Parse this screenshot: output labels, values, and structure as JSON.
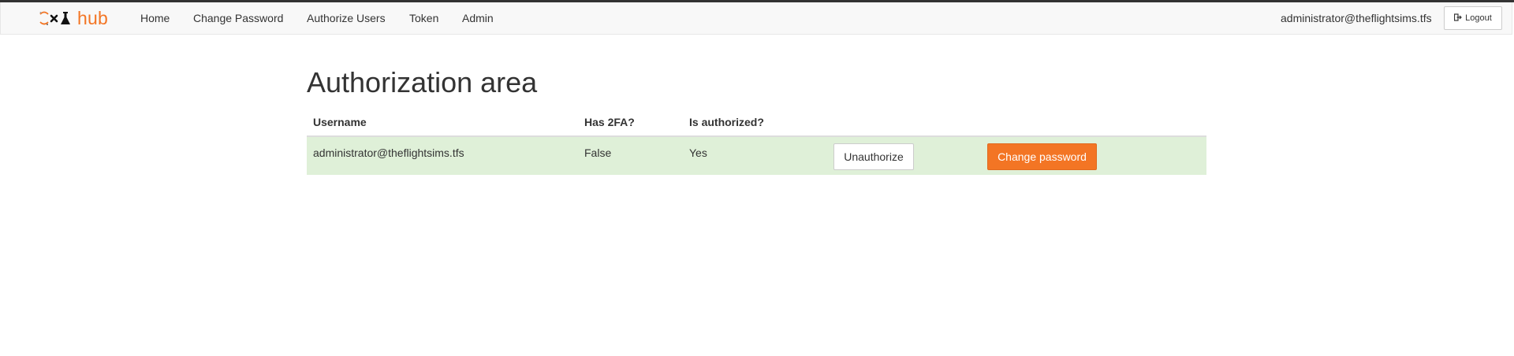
{
  "brand": {
    "logo_text": "hub",
    "accent_color": "#f37524"
  },
  "nav": {
    "items": [
      {
        "label": "Home"
      },
      {
        "label": "Change Password"
      },
      {
        "label": "Authorize Users"
      },
      {
        "label": "Token"
      },
      {
        "label": "Admin"
      }
    ]
  },
  "user": {
    "email": "administrator@theflightsims.tfs",
    "logout_label": "Logout",
    "logout_icon": "sign-out-icon"
  },
  "main": {
    "title": "Authorization area",
    "table": {
      "headers": [
        "Username",
        "Has 2FA?",
        "Is authorized?",
        "",
        ""
      ],
      "rows": [
        {
          "username": "administrator@theflightsims.tfs",
          "has_2fa": "False",
          "is_authorized": "Yes",
          "unauthorize_label": "Unauthorize",
          "change_password_label": "Change password",
          "row_color": "#dff0d8"
        }
      ]
    }
  }
}
